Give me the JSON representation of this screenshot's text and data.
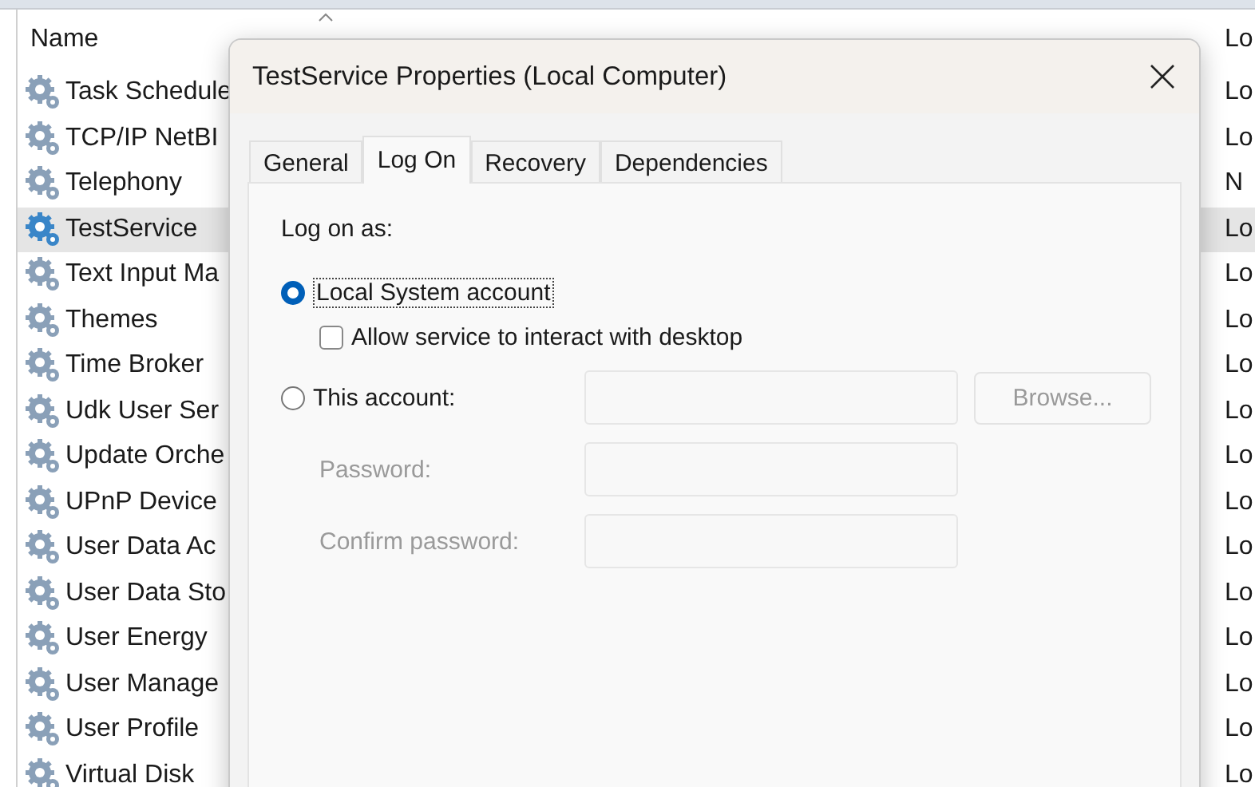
{
  "services": {
    "header": {
      "name": "Name",
      "logon": "Lo"
    },
    "rows": [
      {
        "name": "Task Schedule",
        "logon": "Lo",
        "selected": false
      },
      {
        "name": "TCP/IP NetBI",
        "logon": "Lo",
        "selected": false
      },
      {
        "name": "Telephony",
        "logon": "N",
        "selected": false
      },
      {
        "name": "TestService",
        "logon": "Lo",
        "selected": true
      },
      {
        "name": "Text Input Ma",
        "logon": "Lo",
        "selected": false
      },
      {
        "name": "Themes",
        "logon": "Lo",
        "selected": false
      },
      {
        "name": "Time Broker",
        "logon": "Lo",
        "selected": false
      },
      {
        "name": "Udk User Ser",
        "logon": "Lo",
        "selected": false
      },
      {
        "name": "Update Orche",
        "logon": "Lo",
        "selected": false
      },
      {
        "name": "UPnP Device",
        "logon": "Lo",
        "selected": false
      },
      {
        "name": "User Data Ac",
        "logon": "Lo",
        "selected": false
      },
      {
        "name": "User Data Sto",
        "logon": "Lo",
        "selected": false
      },
      {
        "name": "User Energy",
        "logon": "Lo",
        "selected": false
      },
      {
        "name": "User Manage",
        "logon": "Lo",
        "selected": false
      },
      {
        "name": "User Profile",
        "logon": "Lo",
        "selected": false
      },
      {
        "name": "Virtual Disk",
        "logon": "Lo",
        "selected": false
      }
    ]
  },
  "dialog": {
    "title": "TestService Properties (Local Computer)",
    "tabs": [
      {
        "label": "General",
        "selected": false
      },
      {
        "label": "Log On",
        "selected": true
      },
      {
        "label": "Recovery",
        "selected": false
      },
      {
        "label": "Dependencies",
        "selected": false
      }
    ],
    "log_on_as": "Log on as:",
    "local_system": {
      "label": "Local System account",
      "selected": true
    },
    "interact": {
      "label": "Allow service to interact with desktop",
      "checked": false,
      "disabled": false
    },
    "this_account": {
      "label": "This account:",
      "selected": false
    },
    "account_field": {
      "disabled": true
    },
    "browse": {
      "label": "Browse...",
      "disabled": true
    },
    "password": {
      "label": "Password:",
      "disabled": true
    },
    "confirm": {
      "label": "Confirm password:",
      "disabled": true
    }
  }
}
